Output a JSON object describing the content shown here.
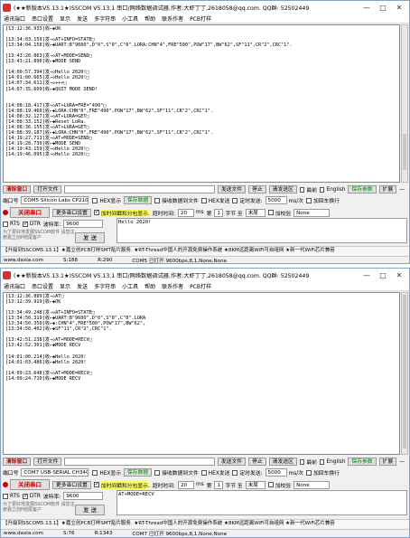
{
  "app": {
    "title": "(★★新版本V5.13.1★)SSCOM V5.13.1 串口/网络数据调试器,作者:大虾丁丁,2618058@qq.com. QQ群: 52502449",
    "menu": [
      "通讯端口",
      "串口设置",
      "显示",
      "发送",
      "多字符串",
      "小工具",
      "帮助",
      "联系作者",
      "PCB打样"
    ],
    "win_min": "—",
    "win_max": "□",
    "win_close": "✕"
  },
  "w1": {
    "log_lines": [
      "[13:12:36.933]收←◆OK",
      "",
      "[13:34:03.159]发→◇AT+INFO=STATE□",
      "[13:34:04.158]收←◆UART:B\"9600\",D\"0\",S\"0\",C\"0\".LORA:CHN\"4\",FRE\"500\",POW\"17\",BW\"62\",SF\"11\",CR\"2\",CRC\"1\".",
      "",
      "[13:43:20.863]发→◇AT+MODE=SEND□",
      "[13:43:21.890]收←◆MODE SEND",
      "",
      "[14:00:57.394]发→◇Hello 2020!□",
      "[14:01:00.665]发→◇Hello 2020!□",
      "[14:07:34.611]发→◇+++□",
      "[14:07:35.609]收←◆QUIT MODE SEND!",
      "",
      "",
      "[14:08:18.417]发→◇AT+LORA=FRE=\"490\"□",
      "[14:08:19.460]收←◆LORA:CHN\"0\",FRE\"490\",POW\"17\",BW\"62\",SF\"11\",CR\"2\",CRC\"1\".",
      "[14:08:32.127]发→◇AT+LORA=GET□",
      "[14:08:33.152]收←◆Reset LoRa.",
      "[14:08:36.155]发→◇AT+LORA=GET□",
      "[14:08:39.187]收←◆LORA:CHN\"0\",FRE\"490\",POW\"17\",BW\"62\",SF\"11\",CR\"2\",CRC\"1\".",
      "[14:19:27.711]发→◇AT+MODE=SEND□",
      "[14:19:28.739]收←◆MODE SEND",
      "[14:19:43.159]发→◇Hello 2020!□",
      "[14:19:46.095]发→◇Hello 2020!□"
    ],
    "port": "COM5 Silicon Labs CP210x U",
    "baud": "9600",
    "send_text": "Hello 2020!",
    "status": {
      "site": "www.daxia.com",
      "s": "S:188",
      "r": "R:290",
      "info": "COM5 已打开  9600bps,8,1,None,None"
    },
    "ad": "【升级到SSCOM5.13.1】★嘉立创PCB打样SMT贴片服务. ★RT-Thread中国人的开源免费操作系统 ★8KM远距离WiFi可自组网 ★新一代WiFi芯片兼容"
  },
  "w2": {
    "log_lines": [
      "[13:12:36.889]发→◇AT□",
      "[13:12:39.919]收←◆OK",
      "",
      "[13:34:49.248]发→◇AT+INFO=STATE□",
      "[13:34:50.319]收←◆UART:B\"9600\",D\"0\",S\"0\",C\"0\".LORA",
      "[13:34:50.350]收←◆:CHN\"4\",FRE\"500\",POW\"17\",BW\"62\",",
      "[13:34:50.402]收←◆SF\"11\",CR\"2\",CRC\"1\".",
      "",
      "[13:42:51.238]发→◇AT+MODE=RECV□",
      "[13:42:52.301]收←◆MODE RECV",
      "",
      "[14:01:00.214]收←◆Hello 2020!",
      "[14:01:03.486]收←◆Hello 2020!",
      "",
      "[14:09:23.648]发→◇AT+MODE=RECV□",
      "[14:09:24.710]收←◆MODE RECV"
    ],
    "port": "COM7 USB-SERIAL CH340",
    "baud": "9600",
    "send_text": "AT+MODE=RECV",
    "status": {
      "site": "www.daxia.com",
      "s": "S:76",
      "r": "R:1343",
      "info": "COM7 已打开  9600bps,8,1,None,None"
    },
    "ad": "【升级到SSCOM5.13.1】★嘉立创PCB打样SMT贴片服务. ★RT-Thread中国人的开源免费操作系统 ★8KM远距离WiFi可自组网 ★新一代WiFi芯片兼容"
  },
  "controls": {
    "clear_window": "清除窗口",
    "open_file": "打开文件",
    "send_file": "发送文件",
    "stop": "停止",
    "clear_send": "清发送区",
    "top_most": "最前",
    "english": "English",
    "save_params": "保存参数",
    "expand": "扩展",
    "minus": "—",
    "port_label": "端口号",
    "hex_display": "HEX显示",
    "save_data": "保存数据",
    "recv_to_file": "接收数据到文件",
    "hex_send": "HEX发送",
    "timed_send": "定时发送:",
    "interval": "5000",
    "interval_unit": "ms/次",
    "add_crlf": "加回车换行",
    "close_port": "关闭串口",
    "more_settings": "更多串口设置",
    "timestamp": "加时间戳和分包显示.",
    "timeout_label": "超时时间:",
    "timeout_val": "20",
    "ms": "ms",
    "byte_label": "第",
    "byte_val": "1",
    "byte_unit": "字节 至",
    "end_label": "末尾",
    "checksum": "加校验",
    "checksum_val": "None",
    "rts": "RTS",
    "dtr": "DTR",
    "baud_label": "波特率:",
    "send": "发 送",
    "promo": "为了更好地发展SSCOM软件 请您注册嘉立创P结尾客户"
  }
}
